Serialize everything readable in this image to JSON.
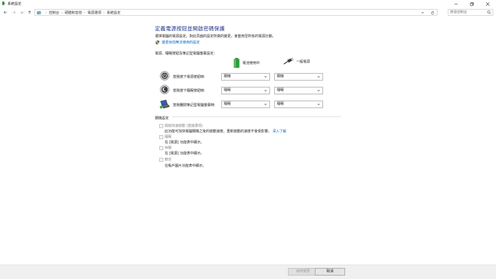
{
  "window": {
    "title": "系統設定"
  },
  "nav": {
    "breadcrumbs": [
      "控制台",
      "硬體和音效",
      "電源選項",
      "系統設定"
    ],
    "search_placeholder": "搜尋控制台"
  },
  "page": {
    "title": "定義電源按鈕並開啟密碼保護",
    "description": "選擇電腦的電源設定。對此頁面的設定所做的變更，會套用至所有的電源計劃。",
    "admin_link": "變更目前無法使用的設定"
  },
  "power_buttons": {
    "heading": "電源、睡眠按鈕及筆記型電腦螢幕設定：",
    "col_battery": "電池使用中",
    "col_plugged": "一般電源",
    "rows": [
      {
        "label": "當我按下電源按鈕時:",
        "battery": "關機",
        "plugged": "關機"
      },
      {
        "label": "當我按下睡眠按鈕時:",
        "battery": "睡眠",
        "plugged": "睡眠"
      },
      {
        "label": "當我闔閉筆記型電腦螢幕時:",
        "battery": "睡眠",
        "plugged": "睡眠"
      }
    ]
  },
  "shutdown_settings": {
    "heading": "關機設定",
    "options": [
      {
        "label": "開啟快速啟動 (建議選項)",
        "desc": "此功能可加快電腦關機之後的啟動速度。重新啟動的速度不會受影響。",
        "link": "深入了解",
        "checked": false
      },
      {
        "label": "睡眠",
        "desc": "在 [電源] 功能表中顯示。",
        "checked": false
      },
      {
        "label": "休眠",
        "desc": "在 [電源] 功能表中顯示。",
        "checked": false
      },
      {
        "label": "鎖定",
        "desc": "在帳戶圖片功能表中顯示。",
        "checked": false
      }
    ]
  },
  "footer": {
    "save": "儲存變更",
    "cancel": "取消"
  },
  "colors": {
    "title_blue": "#1e3287",
    "link_blue": "#0066cc",
    "battery_green": "#2e9a3a"
  }
}
